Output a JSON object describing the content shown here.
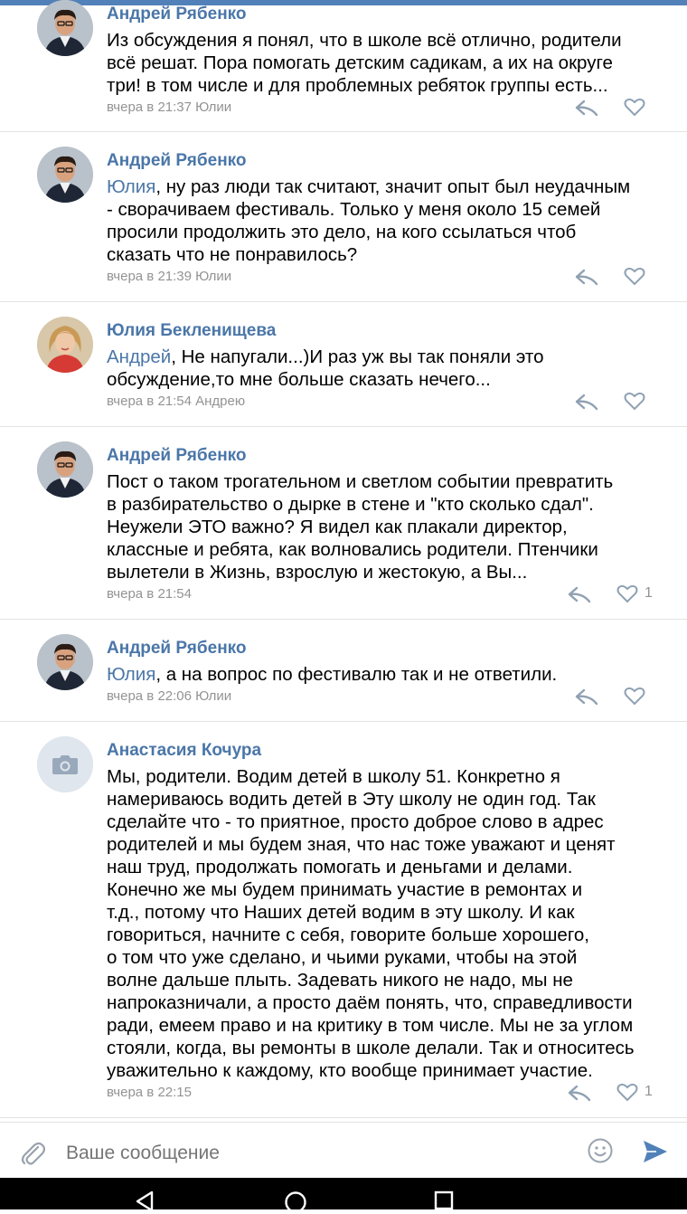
{
  "colors": {
    "accent": "#4a76a8",
    "meta": "#939393",
    "divider": "#e1e3e6",
    "send": "#5181b8"
  },
  "comments": [
    {
      "author": "Андрей Рябенко",
      "avatar": "photo-man",
      "text": "Из обсуждения я понял, что в школе всё отлично, родители\nвсё решат. Пора помогать детским садикам, а их на округе\nтри! в том числе и для проблемных ребяток группы есть...",
      "meta": "вчера в 21:37 Юлии",
      "likes": ""
    },
    {
      "author": "Андрей Рябенко",
      "avatar": "photo-man",
      "mention": "Юлия",
      "text": ", ну раз люди так считают, значит опыт был неудачным\n- сворачиваем фестиваль. Только у меня около 15 семей\nпросили продолжить это дело, на кого ссылаться чтоб\nсказать что не понравилось?",
      "meta": "вчера в 21:39 Юлии",
      "likes": ""
    },
    {
      "author": "Юлия Бекленищева",
      "avatar": "photo-woman",
      "mention": "Андрей",
      "text": ", Не напугали...)И раз уж  вы так поняли это\nобсуждение,то мне больше сказать нечего...",
      "meta": "вчера в 21:54 Андрею",
      "likes": ""
    },
    {
      "author": "Андрей Рябенко",
      "avatar": "photo-man",
      "text": "Пост о таком трогательном и светлом событии превратить\nв разбирательство о дырке в стене и \"кто сколько сдал\".\nНеужели ЭТО важно? Я видел как плакали директор,\nклассные и ребята, как волновались родители. Птенчики\nвылетели в Жизнь, взрослую и жестокую, а Вы...",
      "meta": "вчера в 21:54",
      "likes": "1"
    },
    {
      "author": "Андрей Рябенко",
      "avatar": "photo-man",
      "mention": "Юлия",
      "text": ", а на вопрос по фестивалю так и не ответили.",
      "meta": "вчера в 22:06 Юлии",
      "likes": ""
    },
    {
      "author": "Анастасия Кочура",
      "avatar": "camera-placeholder-icon",
      "text": "Мы, родители. Водим детей в школу 51. Конкретно я\nнамериваюсь водить детей в Эту школу не один год. Так\nсделайте что - то приятное, просто доброе слово в адрес\nродителей и мы будем зная, что нас тоже уважают и ценят\nнаш труд, продолжать помогать и деньгами и делами.\nКонечно же мы будем принимать участие в ремонтах и\nт.д., потому что Наших детей водим в эту школу. И как\nговориться, начните с себя, говорите больше хорошего,\nо том что уже сделано, и чьими руками, чтобы на этой\nволне дальше плыть. Задевать никого не надо, мы не\nнапроказничали, а просто даём понять, что, справедливости\nради, емеем право и на критику в том числе. Мы не за углом\nстояли, когда, вы ремонты в школе делали. Так и относитесь\nуважительно к каждому, кто вообще принимает участие.",
      "meta": "вчера в 22:15",
      "likes": "1"
    }
  ],
  "composer": {
    "placeholder": "Ваше сообщение",
    "attach_icon": "paperclip-icon",
    "emoji_icon": "smile-icon",
    "send_icon": "send-arrow-icon"
  },
  "navbar": {
    "icons": [
      "back-triangle-icon",
      "home-circle-icon",
      "recents-square-icon"
    ]
  }
}
